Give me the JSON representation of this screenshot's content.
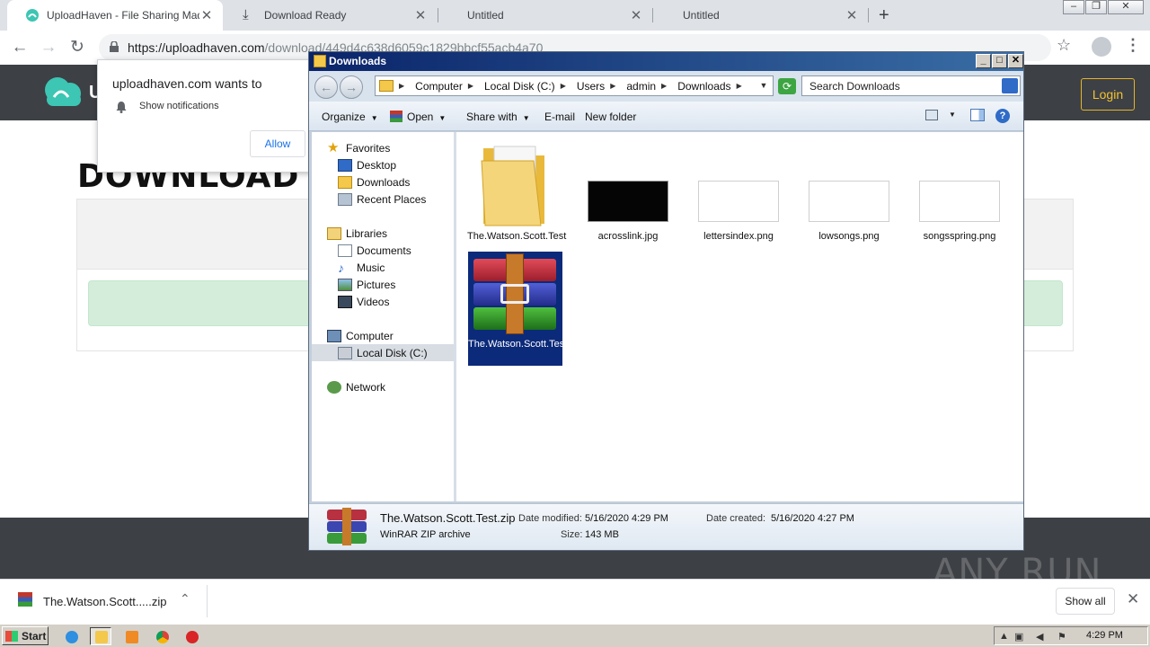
{
  "browser": {
    "tabs": [
      {
        "label": "UploadHaven - File Sharing Made Sir"
      },
      {
        "label": "Download Ready"
      },
      {
        "label": "Untitled"
      },
      {
        "label": "Untitled"
      }
    ],
    "new_tab": "+",
    "url_host": "https://uploadhaven.com",
    "url_path": "/download/449d4c638d6059c1829bbcf55acb4a70"
  },
  "website": {
    "logo_letter": "U",
    "login_label": "Login",
    "page_heading": "DOWNLOAD F"
  },
  "notification": {
    "title": "uploadhaven.com wants to",
    "text": "Show notifications",
    "allow_label": "Allow"
  },
  "explorer": {
    "title": "Downloads",
    "breadcrumbs": [
      "Computer",
      "Local Disk (C:)",
      "Users",
      "admin",
      "Downloads"
    ],
    "search_placeholder": "Search Downloads",
    "commands": {
      "organize": "Organize",
      "open": "Open",
      "share_with": "Share with",
      "email": "E-mail",
      "new_folder": "New folder"
    },
    "nav": {
      "favorites": "Favorites",
      "desktop": "Desktop",
      "downloads": "Downloads",
      "recent_places": "Recent Places",
      "libraries": "Libraries",
      "documents": "Documents",
      "music": "Music",
      "pictures": "Pictures",
      "videos": "Videos",
      "computer": "Computer",
      "local_disk": "Local Disk (C:)",
      "network": "Network"
    },
    "files": [
      {
        "name": "The.Watson.Scott.Test",
        "type": "folder"
      },
      {
        "name": "acrosslink.jpg",
        "type": "image"
      },
      {
        "name": "lettersindex.png",
        "type": "image"
      },
      {
        "name": "lowsongs.png",
        "type": "image"
      },
      {
        "name": "songsspring.png",
        "type": "image"
      },
      {
        "name": "The.Watson.Scott.Test.zip",
        "type": "winrar-archive",
        "selected": true
      }
    ],
    "details": {
      "name": "The.Watson.Scott.Test.zip",
      "type": "WinRAR ZIP archive",
      "modified_label": "Date modified:",
      "modified": "5/16/2020 4:29 PM",
      "created_label": "Date created:",
      "created": "5/16/2020 4:27 PM",
      "size_label": "Size:",
      "size": "143 MB"
    }
  },
  "download_bar": {
    "item_name": "The.Watson.Scott.....zip",
    "show_all_label": "Show all"
  },
  "watermark": "ANY RUN",
  "taskbar": {
    "start_label": "Start",
    "clock": "4:29 PM"
  }
}
